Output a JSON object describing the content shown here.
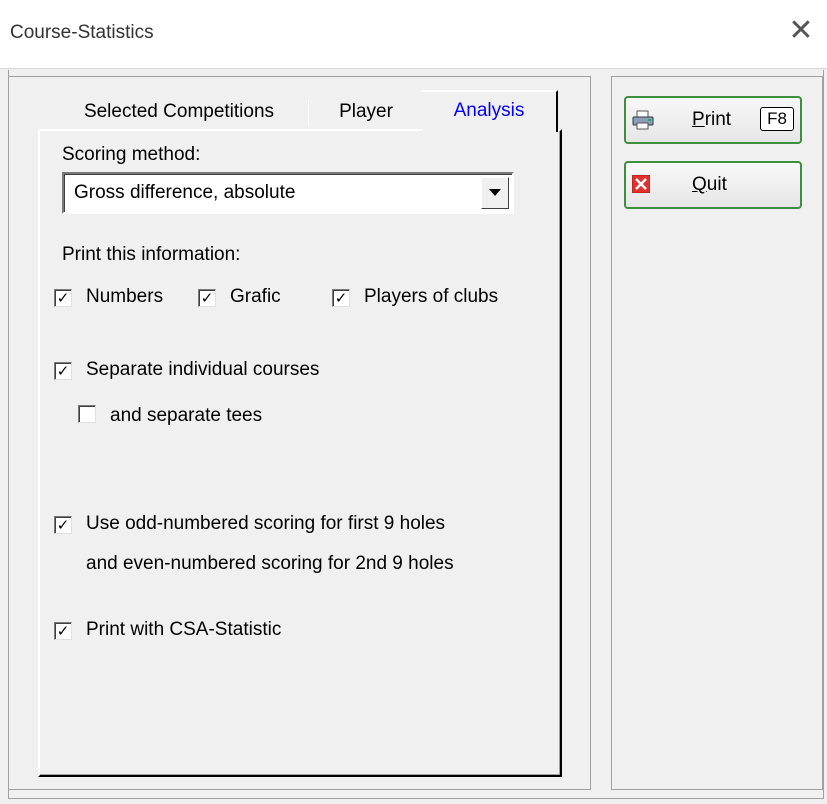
{
  "window": {
    "title": "Course-Statistics",
    "close_glyph": "✕"
  },
  "tabs": {
    "selected_competitions": "Selected Competitions",
    "player": "Player",
    "analysis": "Analysis"
  },
  "scoring": {
    "label": "Scoring method:",
    "value": "Gross difference, absolute"
  },
  "print_info": {
    "label": "Print this information:",
    "numbers": {
      "label": "Numbers",
      "checked": true
    },
    "grafic": {
      "label": "Grafic",
      "checked": true
    },
    "players_of_clubs": {
      "label": "Players of clubs",
      "checked": true
    }
  },
  "separate_courses": {
    "label": "Separate individual courses",
    "checked": true
  },
  "separate_tees": {
    "label": "and separate tees",
    "checked": false
  },
  "odd_even": {
    "label": "Use odd-numbered scoring for first 9 holes",
    "label2": "and even-numbered scoring for 2nd 9 holes",
    "checked": true
  },
  "csa": {
    "label": "Print with CSA-Statistic",
    "checked": true
  },
  "buttons": {
    "print": {
      "label_first": "P",
      "label_rest": "rint",
      "shortcut": "F8",
      "icon": "printer-icon"
    },
    "quit": {
      "label_first": "Q",
      "label_rest": "uit",
      "icon": "close-icon"
    }
  },
  "colors": {
    "active_tab": "#0000ff",
    "button_border": "#3d8f3d",
    "quit_icon": "#e03030"
  }
}
